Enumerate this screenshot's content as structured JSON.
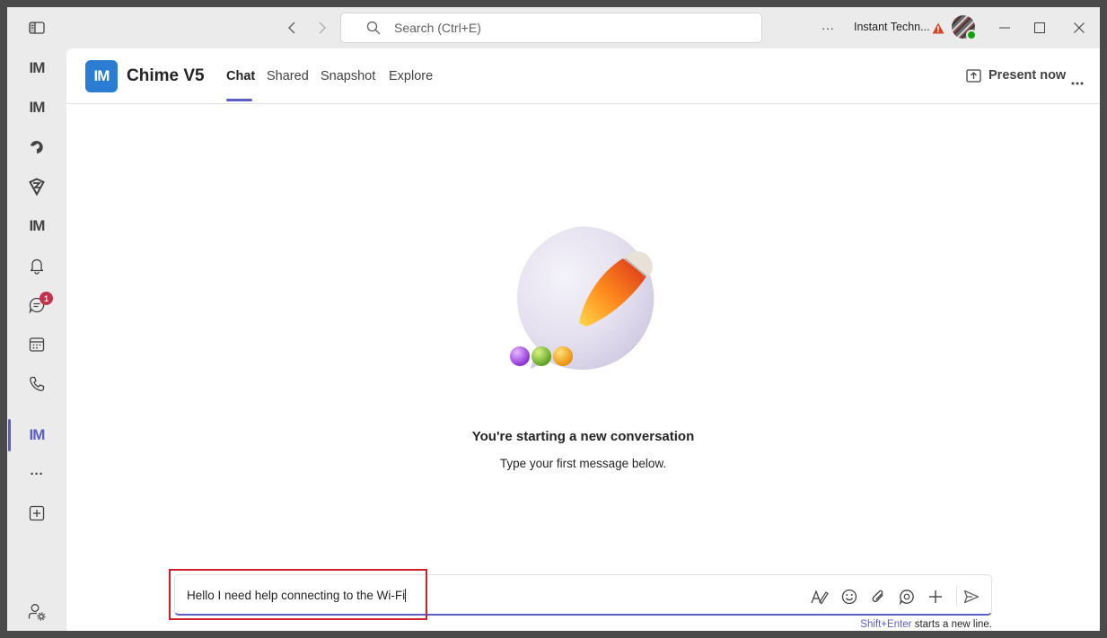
{
  "titlebar": {
    "search_placeholder": "Search (Ctrl+E)",
    "org_name": "Instant Techn...",
    "more_label": "···"
  },
  "rail": {
    "items": [
      {
        "id": "app-im-1",
        "label": "IM"
      },
      {
        "id": "app-im-2",
        "label": "IM"
      },
      {
        "id": "app-loop",
        "label": ""
      },
      {
        "id": "app-shield",
        "label": ""
      },
      {
        "id": "app-im-3",
        "label": "IM"
      },
      {
        "id": "activity",
        "label": ""
      },
      {
        "id": "chat",
        "label": "",
        "badge": "1"
      },
      {
        "id": "calendar",
        "label": ""
      },
      {
        "id": "calls",
        "label": ""
      },
      {
        "id": "app-im-active",
        "label": "IM"
      },
      {
        "id": "more-apps",
        "label": "···"
      },
      {
        "id": "add-app",
        "label": ""
      }
    ],
    "accent_color": "#5b5fc7",
    "badge_color": "#c4314b"
  },
  "header": {
    "logo_text": "IM",
    "app_title": "Chime V5",
    "tabs": [
      {
        "label": "Chat",
        "active": true
      },
      {
        "label": "Shared",
        "active": false
      },
      {
        "label": "Snapshot",
        "active": false
      },
      {
        "label": "Explore",
        "active": false
      }
    ],
    "present_label": "Present now"
  },
  "empty_state": {
    "title": "You're starting a new conversation",
    "subtitle": "Type your first message below."
  },
  "compose": {
    "value": "Hello I need help connecting to the Wi-Fi",
    "hint_key": "Shift+Enter",
    "hint_text": " starts a new line."
  }
}
